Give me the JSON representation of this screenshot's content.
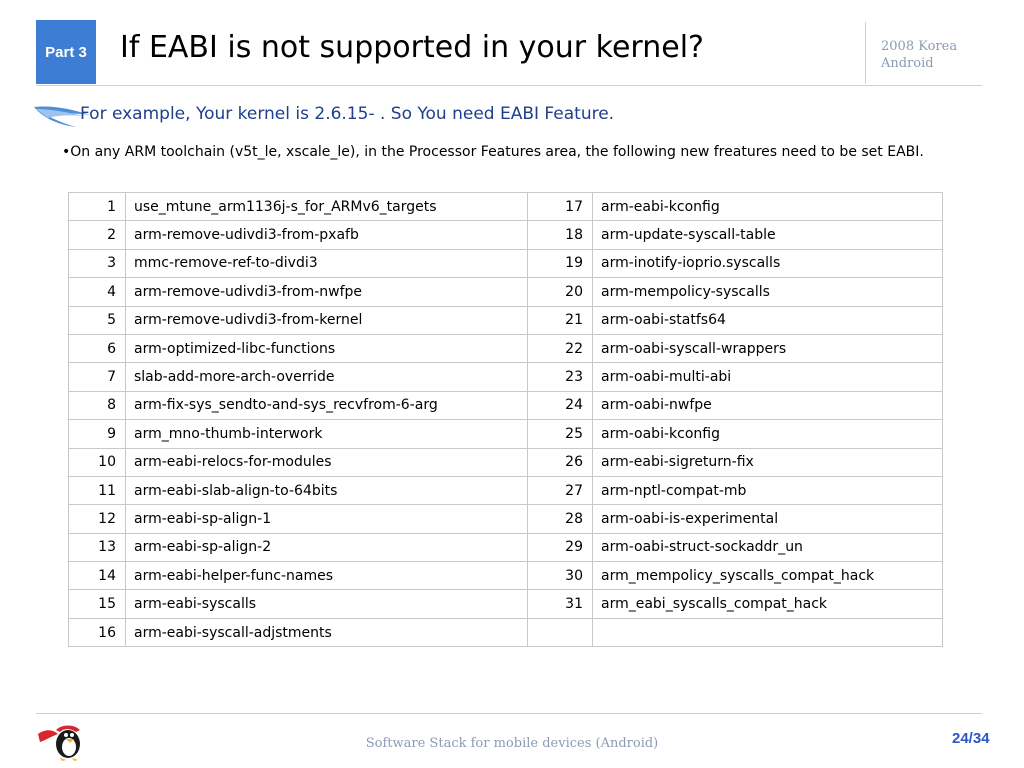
{
  "header": {
    "part_label": "Part 3",
    "title": "If EABI is not supported in your kernel?",
    "brand_line1": "2008 Korea",
    "brand_line2": "Android"
  },
  "subtitle": "For example, Your kernel is 2.6.15- . So You need EABI Feature.",
  "body": {
    "text_before": "•On any ARM toolchain (v5t_le, xscale_le), in the ",
    "highlight": "Processor Features",
    "text_after": " area, the following new freatures need to be set  EABI."
  },
  "table": {
    "rows": [
      {
        "n1": "1",
        "p1": "use_mtune_arm1136j-s_for_ARMv6_targets",
        "n2": "17",
        "p2": "arm-eabi-kconfig"
      },
      {
        "n1": "2",
        "p1": "arm-remove-udivdi3-from-pxafb",
        "n2": "18",
        "p2": "arm-update-syscall-table"
      },
      {
        "n1": "3",
        "p1": "mmc-remove-ref-to-divdi3",
        "n2": "19",
        "p2": "arm-inotify-ioprio.syscalls"
      },
      {
        "n1": "4",
        "p1": "arm-remove-udivdi3-from-nwfpe",
        "n2": "20",
        "p2": "arm-mempolicy-syscalls"
      },
      {
        "n1": "5",
        "p1": "arm-remove-udivdi3-from-kernel",
        "n2": "21",
        "p2": "arm-oabi-statfs64"
      },
      {
        "n1": "6",
        "p1": "arm-optimized-libc-functions",
        "n2": "22",
        "p2": "arm-oabi-syscall-wrappers"
      },
      {
        "n1": "7",
        "p1": "slab-add-more-arch-override",
        "n2": "23",
        "p2": "arm-oabi-multi-abi"
      },
      {
        "n1": "8",
        "p1": "arm-fix-sys_sendto-and-sys_recvfrom-6-arg",
        "n2": "24",
        "p2": "arm-oabi-nwfpe"
      },
      {
        "n1": "9",
        "p1": "arm_mno-thumb-interwork",
        "n2": "25",
        "p2": "arm-oabi-kconfig"
      },
      {
        "n1": "10",
        "p1": "arm-eabi-relocs-for-modules",
        "n2": "26",
        "p2": "arm-eabi-sigreturn-fix"
      },
      {
        "n1": "11",
        "p1": "arm-eabi-slab-align-to-64bits",
        "n2": "27",
        "p2": "arm-nptl-compat-mb"
      },
      {
        "n1": "12",
        "p1": "arm-eabi-sp-align-1",
        "n2": "28",
        "p2": "arm-oabi-is-experimental"
      },
      {
        "n1": "13",
        "p1": "arm-eabi-sp-align-2",
        "n2": "29",
        "p2": "arm-oabi-struct-sockaddr_un"
      },
      {
        "n1": "14",
        "p1": "arm-eabi-helper-func-names",
        "n2": "30",
        "p2": "arm_mempolicy_syscalls_compat_hack"
      },
      {
        "n1": "15",
        "p1": "arm-eabi-syscalls",
        "n2": "31",
        "p2": "arm_eabi_syscalls_compat_hack"
      },
      {
        "n1": "16",
        "p1": "arm-eabi-syscall-adjstments",
        "n2": "",
        "p2": ""
      }
    ]
  },
  "footer": {
    "text": "Software Stack for mobile devices (Android)",
    "page": "24/34"
  },
  "colors": {
    "part_box": "#3d7ed4",
    "subtitle": "#1f3e8c",
    "brand": "#8b9bb4",
    "page_num": "#2b55c8",
    "table_border": "#c8c8c8"
  },
  "icons": {
    "swoosh": "blue-swoosh-icon",
    "mascot": "penguin-mascot-icon"
  }
}
